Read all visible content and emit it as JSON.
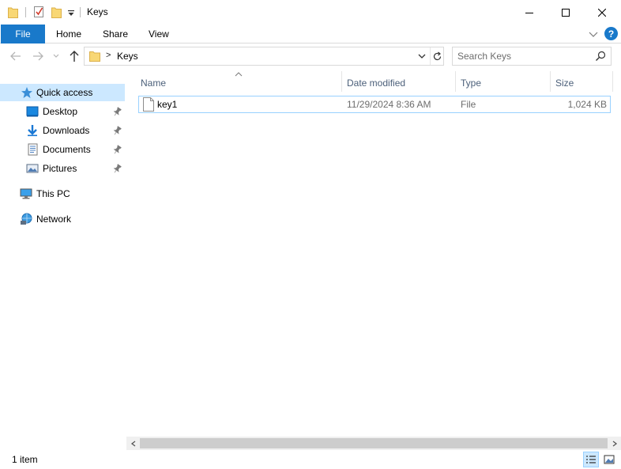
{
  "window": {
    "title": "Keys"
  },
  "ribbon": {
    "tabs": [
      {
        "label": "File"
      },
      {
        "label": "Home"
      },
      {
        "label": "Share"
      },
      {
        "label": "View"
      }
    ],
    "help_label": "?"
  },
  "navigation": {
    "address": {
      "separator": ">",
      "current": "Keys"
    },
    "search": {
      "placeholder": "Search Keys",
      "value": ""
    }
  },
  "sidebar": {
    "items": [
      {
        "label": "Quick access",
        "icon": "star-icon",
        "selected": true
      },
      {
        "label": "Desktop",
        "icon": "desktop-icon",
        "pinned": true
      },
      {
        "label": "Downloads",
        "icon": "download-icon",
        "pinned": true
      },
      {
        "label": "Documents",
        "icon": "documents-icon",
        "pinned": true
      },
      {
        "label": "Pictures",
        "icon": "pictures-icon",
        "pinned": true
      },
      {
        "label": "This PC",
        "icon": "computer-icon"
      },
      {
        "label": "Network",
        "icon": "network-icon"
      }
    ]
  },
  "file_list": {
    "columns": [
      {
        "label": "Name"
      },
      {
        "label": "Date modified"
      },
      {
        "label": "Type"
      },
      {
        "label": "Size"
      }
    ],
    "rows": [
      {
        "name": "key1",
        "date_modified": "11/29/2024 8:36 AM",
        "type": "File",
        "size": "1,024 KB"
      }
    ]
  },
  "status": {
    "item_count": "1 item"
  },
  "colors": {
    "accent": "#1979ca",
    "selection": "#cce8ff",
    "selection_border": "#99d1ff",
    "column_header_text": "#4c607a"
  }
}
